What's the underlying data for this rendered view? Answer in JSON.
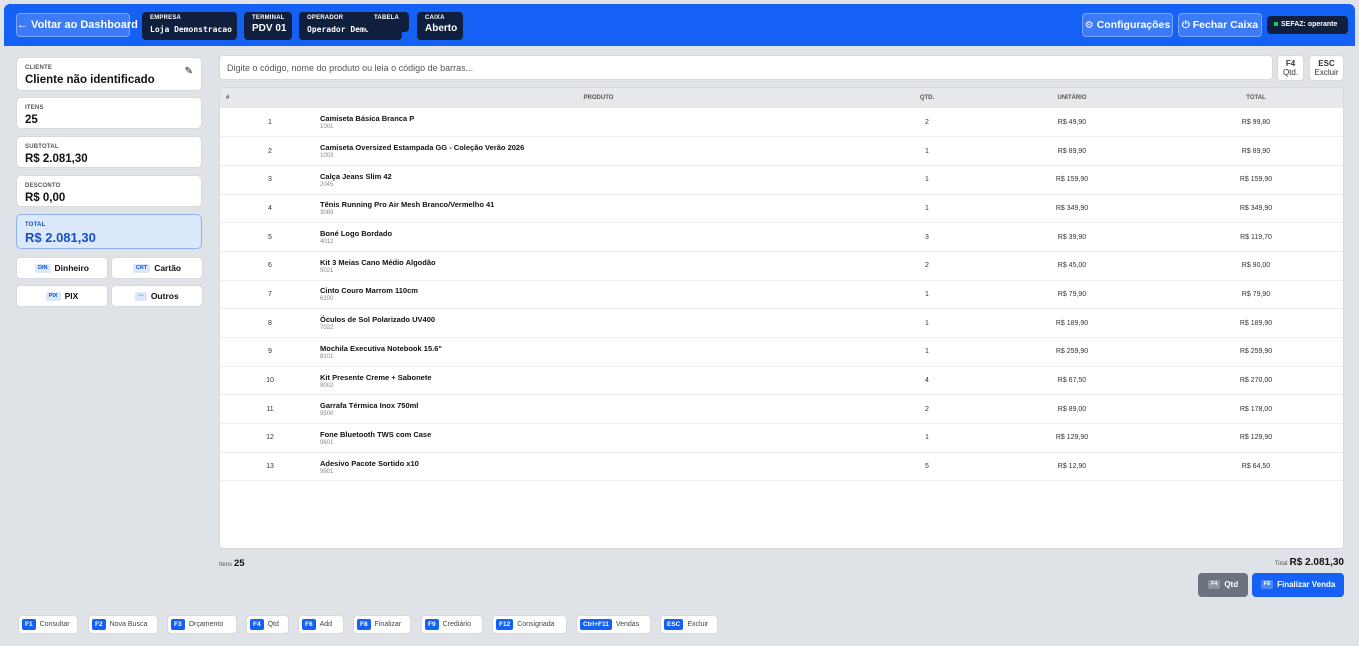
{
  "header": {
    "back_label": "← Voltar ao Dashboard",
    "chips": [
      {
        "label": "EMPRESA",
        "value": "Loja Demonstracao"
      },
      {
        "label": "TERMINAL",
        "value": "PDV 01"
      },
      {
        "label": "OPERADOR",
        "value": "Operador Demo"
      },
      {
        "label": "TABELA",
        "value": ""
      },
      {
        "label": "CAIXA",
        "value": "Aberto"
      }
    ],
    "config_label": "Configurações",
    "config_icon": "gear-icon",
    "close_label": "Fechar Caixa",
    "close_icon": "power-icon",
    "sefaz_label": "SEFAZ: operante",
    "sefaz_color": "#22c55e"
  },
  "left": {
    "cliente": {
      "label": "CLIENTE",
      "value": "Cliente não identificado"
    },
    "itens": {
      "label": "ITENS",
      "value": "25"
    },
    "subtotal": {
      "label": "SUBTOTAL",
      "value": "R$ 2.081,30"
    },
    "desconto": {
      "label": "DESCONTO",
      "value": "R$ 0,00"
    },
    "total": {
      "label": "TOTAL",
      "value": "R$ 2.081,30"
    },
    "payments": [
      {
        "tag": "DIN",
        "label": "Dinheiro"
      },
      {
        "tag": "CRT",
        "label": "Cartão"
      },
      {
        "tag": "PIX",
        "label": "PIX"
      },
      {
        "tag": "···",
        "label": "Outros"
      }
    ]
  },
  "search": {
    "placeholder": "Digite o código, nome do produto ou leia o código de barras...",
    "f4_key": "F4",
    "f4_label": "Qtd.",
    "esc_key": "ESC",
    "esc_label": "Excluir"
  },
  "table": {
    "columns": [
      "#",
      "PRODUTO",
      "QTD.",
      "UNITÁRIO",
      "TOTAL"
    ],
    "rows": [
      {
        "n": "1",
        "name": "Camiseta Básica Branca P",
        "code": "1001",
        "qtd": "2",
        "unit": "R$ 49,90",
        "total": "R$ 99,80"
      },
      {
        "n": "2",
        "name": "Camiseta Oversized Estampada GG - Coleção Verão 2026",
        "code": "1003",
        "qtd": "1",
        "unit": "R$ 89,90",
        "total": "R$ 89,90"
      },
      {
        "n": "3",
        "name": "Calça Jeans Slim 42",
        "code": "2045",
        "qtd": "1",
        "unit": "R$ 159,90",
        "total": "R$ 159,90"
      },
      {
        "n": "4",
        "name": "Tênis Running Pro Air Mesh Branco/Vermelho 41",
        "code": "3089",
        "qtd": "1",
        "unit": "R$ 349,90",
        "total": "R$ 349,90"
      },
      {
        "n": "5",
        "name": "Boné Logo Bordado",
        "code": "4012",
        "qtd": "3",
        "unit": "R$ 39,90",
        "total": "R$ 119,70"
      },
      {
        "n": "6",
        "name": "Kit 3 Meias Cano Médio Algodão",
        "code": "5021",
        "qtd": "2",
        "unit": "R$ 45,00",
        "total": "R$ 90,00"
      },
      {
        "n": "7",
        "name": "Cinto Couro Marrom 110cm",
        "code": "6100",
        "qtd": "1",
        "unit": "R$ 79,90",
        "total": "R$ 79,90"
      },
      {
        "n": "8",
        "name": "Óculos de Sol Polarizado UV400",
        "code": "7022",
        "qtd": "1",
        "unit": "R$ 189,90",
        "total": "R$ 189,90"
      },
      {
        "n": "9",
        "name": "Mochila Executiva Notebook 15.6\"",
        "code": "8101",
        "qtd": "1",
        "unit": "R$ 259,90",
        "total": "R$ 259,90"
      },
      {
        "n": "10",
        "name": "Kit Presente Creme + Sabonete",
        "code": "9002",
        "qtd": "4",
        "unit": "R$ 67,50",
        "total": "R$ 270,00"
      },
      {
        "n": "11",
        "name": "Garrafa Térmica Inox 750ml",
        "code": "9500",
        "qtd": "2",
        "unit": "R$ 89,00",
        "total": "R$ 178,00"
      },
      {
        "n": "12",
        "name": "Fone Bluetooth TWS com Case",
        "code": "9601",
        "qtd": "1",
        "unit": "R$ 129,90",
        "total": "R$ 129,90"
      },
      {
        "n": "13",
        "name": "Adesivo Pacote Sortido x10",
        "code": "9901",
        "qtd": "5",
        "unit": "R$ 12,90",
        "total": "R$ 64,50"
      }
    ]
  },
  "footer": {
    "itens_label": "Itens",
    "itens_value": "25",
    "total_label": "Total",
    "total_value": "R$ 2.081,30",
    "qtd_key": "F4",
    "qtd_label": "Qtd",
    "fin_key": "F8",
    "fin_label": "Finalizar Venda"
  },
  "shortcuts": [
    {
      "key": "F1",
      "label": "Consultar"
    },
    {
      "key": "F2",
      "label": "Nova Busca"
    },
    {
      "key": "F3",
      "label": "Orçamento"
    },
    {
      "key": "F4",
      "label": "Qtd"
    },
    {
      "key": "F6",
      "label": "Add"
    },
    {
      "key": "F8",
      "label": "Finalizar"
    },
    {
      "key": "F9",
      "label": "Crediário"
    },
    {
      "key": "F12",
      "label": "Consignada"
    },
    {
      "key": "Ctrl+F11",
      "label": "Vendas"
    },
    {
      "key": "ESC",
      "label": "Excluir"
    }
  ]
}
